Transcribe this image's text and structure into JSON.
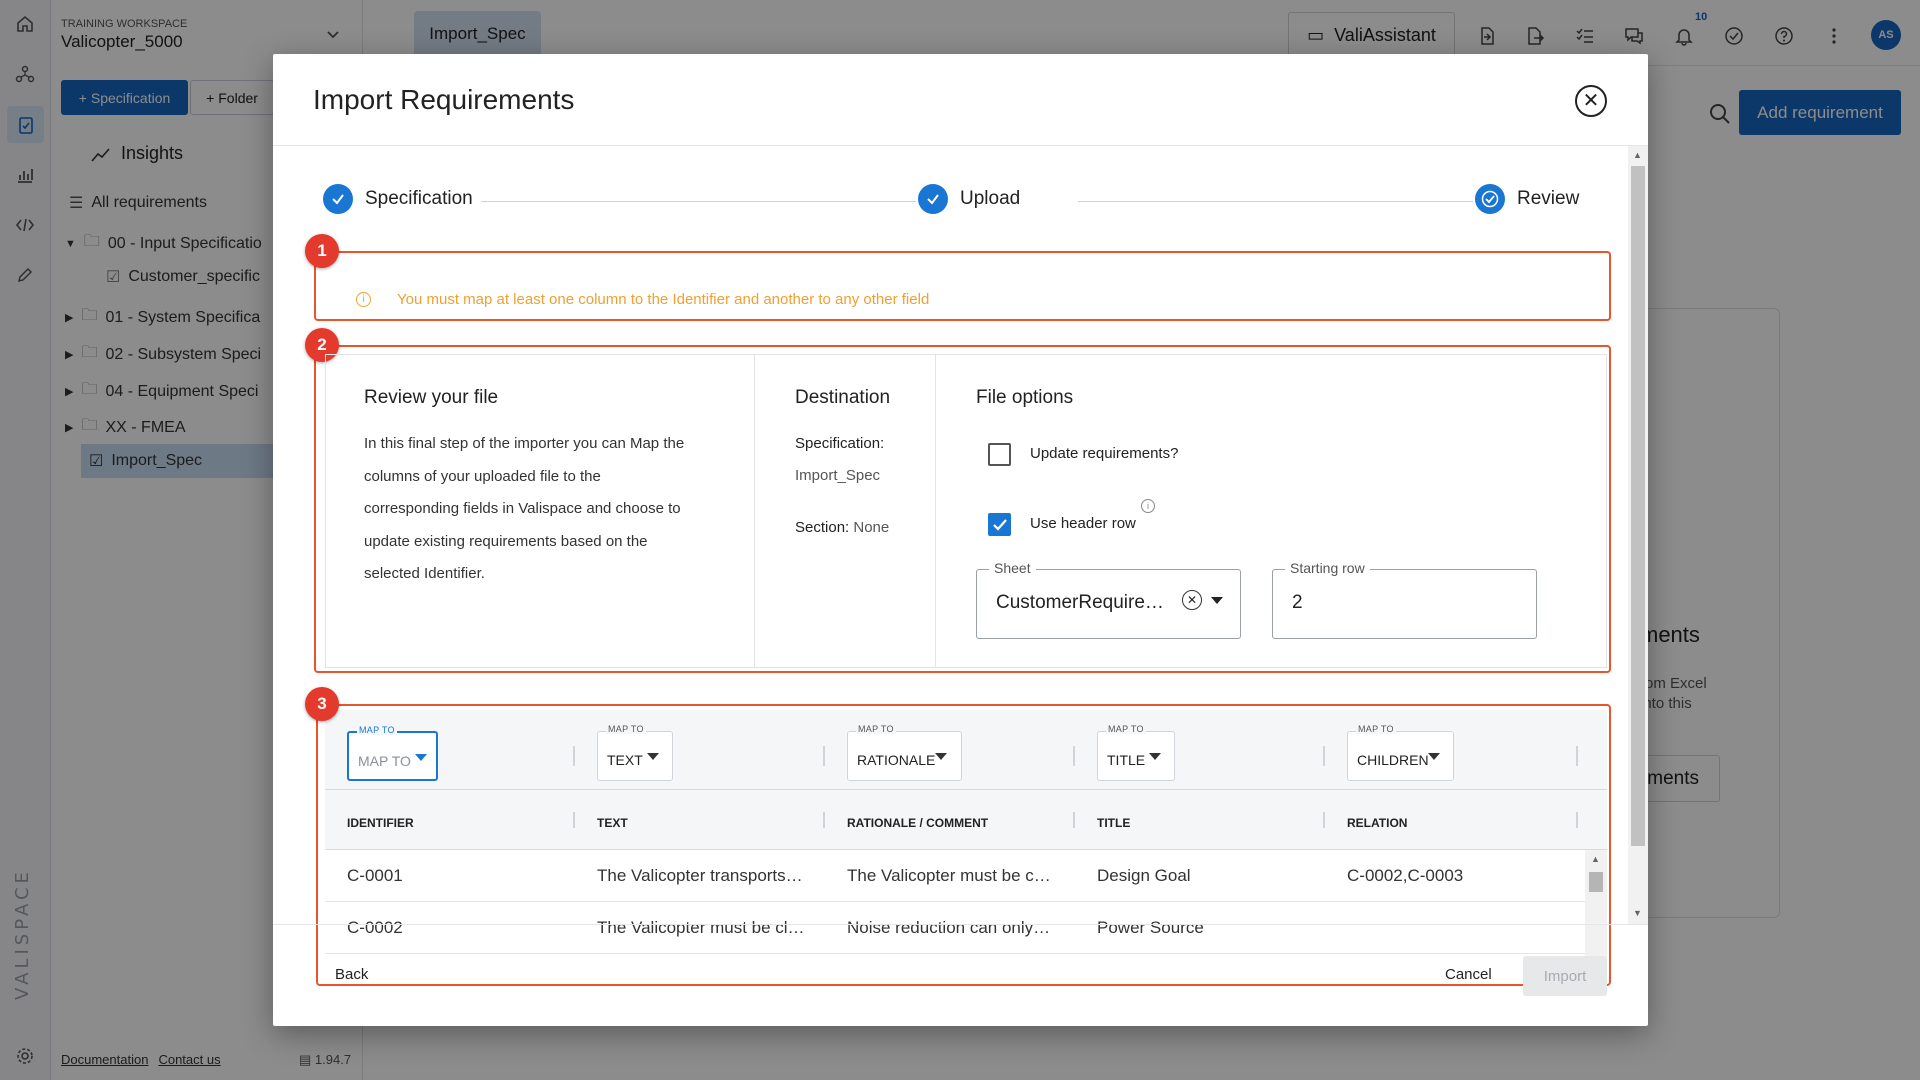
{
  "workspace": {
    "label": "TRAINING WORKSPACE",
    "name": "Valicopter_5000"
  },
  "sidebar": {
    "btn_spec": "Specification",
    "btn_folder": "Folder",
    "insights": "Insights",
    "tree": [
      {
        "label": "All requirements"
      },
      {
        "label": "00 - Input Specificatio"
      },
      {
        "label": "Customer_specific"
      },
      {
        "label": "01 - System Specifica"
      },
      {
        "label": "02 - Subsystem Speci"
      },
      {
        "label": "04 - Equipment Speci"
      },
      {
        "label": "XX - FMEA"
      },
      {
        "label": "Import_Spec"
      }
    ],
    "footer": {
      "documentation": "Documentation",
      "contact": "Contact us",
      "version": "1.94.7"
    }
  },
  "topbar": {
    "tab": "Import_Spec",
    "assistant": "ValiAssistant",
    "notifications": "10",
    "avatar": "AS"
  },
  "background": {
    "add_requirement": "Add requirement",
    "card_title": "ments",
    "card_text": "rom Excel into this",
    "card_button": "ments"
  },
  "modal": {
    "title": "Import Requirements",
    "steps": [
      {
        "label": "Specification"
      },
      {
        "label": "Upload"
      },
      {
        "label": "Review"
      }
    ],
    "markers": [
      "1",
      "2",
      "3"
    ],
    "warning": "You must map at least one column to the Identifier and another to any other field",
    "review": {
      "heading": "Review your file",
      "lines": [
        "In this final step of the importer you can Map the",
        "columns of your uploaded file to the",
        "corresponding fields in Valispace and choose to",
        "update existing requirements based on the",
        "selected Identifier."
      ]
    },
    "destination": {
      "heading": "Destination",
      "spec_label": "Specification:",
      "spec_value": "Import_Spec",
      "section_label": "Section:",
      "section_value": "None"
    },
    "file_options": {
      "heading": "File options",
      "update_label": "Update requirements?",
      "update_checked": false,
      "header_label": "Use header row",
      "header_checked": true,
      "sheet_label": "Sheet",
      "sheet_value": "CustomerRequire…",
      "start_label": "Starting row",
      "start_value": "2"
    },
    "mapping": {
      "map_label": "MAP TO",
      "selects": [
        "MAP TO",
        "TEXT",
        "RATIONALE",
        "TITLE",
        "CHILDREN"
      ],
      "headers": [
        "IDENTIFIER",
        "TEXT",
        "RATIONALE / COMMENT",
        "TITLE",
        "RELATION"
      ],
      "rows": [
        [
          "C-0001",
          "The Valicopter transports…",
          "The Valicopter must be c…",
          "Design Goal",
          "C-0002,C-0003"
        ],
        [
          "C-0002",
          "The Valicopter must be cl…",
          "Noise reduction can only…",
          "Power Source",
          ""
        ]
      ]
    },
    "footer": {
      "back": "Back",
      "cancel": "Cancel",
      "import": "Import"
    }
  },
  "colors": {
    "accent": "#1976d2",
    "primary_button": "#1565c0",
    "highlight": "#e8552b",
    "marker": "#e33a2d",
    "warning": "#f0a030"
  },
  "icons": [
    "home-icon",
    "network-icon",
    "clipboard-icon",
    "analytics-icon",
    "code-icon",
    "pencil-icon",
    "settings-icon",
    "chevron-down-icon",
    "search-icon",
    "close-icon",
    "check-icon",
    "info-icon",
    "bell-icon",
    "help-icon",
    "more-icon"
  ]
}
